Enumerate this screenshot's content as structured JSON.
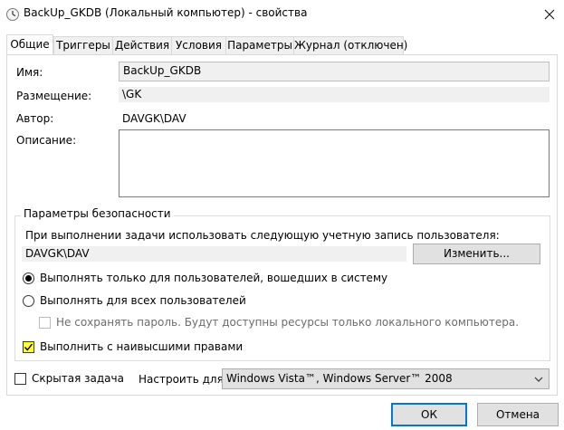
{
  "window": {
    "title": "BackUp_GKDB (Локальный компьютер) - свойства"
  },
  "tabs": [
    {
      "label": "Общие",
      "active": true
    },
    {
      "label": "Триггеры",
      "active": false
    },
    {
      "label": "Действия",
      "active": false
    },
    {
      "label": "Условия",
      "active": false
    },
    {
      "label": "Параметры",
      "active": false
    },
    {
      "label": "Журнал (отключен)",
      "active": false
    }
  ],
  "general": {
    "name_label": "Имя:",
    "name_value": "BackUp_GKDB",
    "location_label": "Размещение:",
    "location_value": "\\GK",
    "author_label": "Автор:",
    "author_value": "DAVGK\\DAV",
    "description_label": "Описание:",
    "description_value": ""
  },
  "security": {
    "legend": "Параметры безопасности",
    "account_prompt": "При выполнении задачи использовать следующую учетную запись пользователя:",
    "account_value": "DAVGK\\DAV",
    "change_button": "Изменить...",
    "radio_logged_on": "Выполнять только для пользователей, вошедших в систему",
    "radio_logged_on_selected": true,
    "radio_all_users": "Выполнять для всех пользователей",
    "radio_all_users_selected": false,
    "no_store_password": "Не сохранять пароль. Будут доступны ресурсы только локального компьютера.",
    "no_store_password_checked": false,
    "highest_privileges": "Выполнить с наивысшими правами",
    "highest_privileges_checked": true
  },
  "hidden_task": {
    "label": "Скрытая задача",
    "checked": false
  },
  "configure": {
    "label": "Настроить для:",
    "selected": "Windows Vista™, Windows Server™ 2008"
  },
  "buttons": {
    "ok": "ОК",
    "cancel": "Отмена"
  },
  "colors": {
    "highlight": "#ffff33",
    "accent": "#0078d7"
  }
}
